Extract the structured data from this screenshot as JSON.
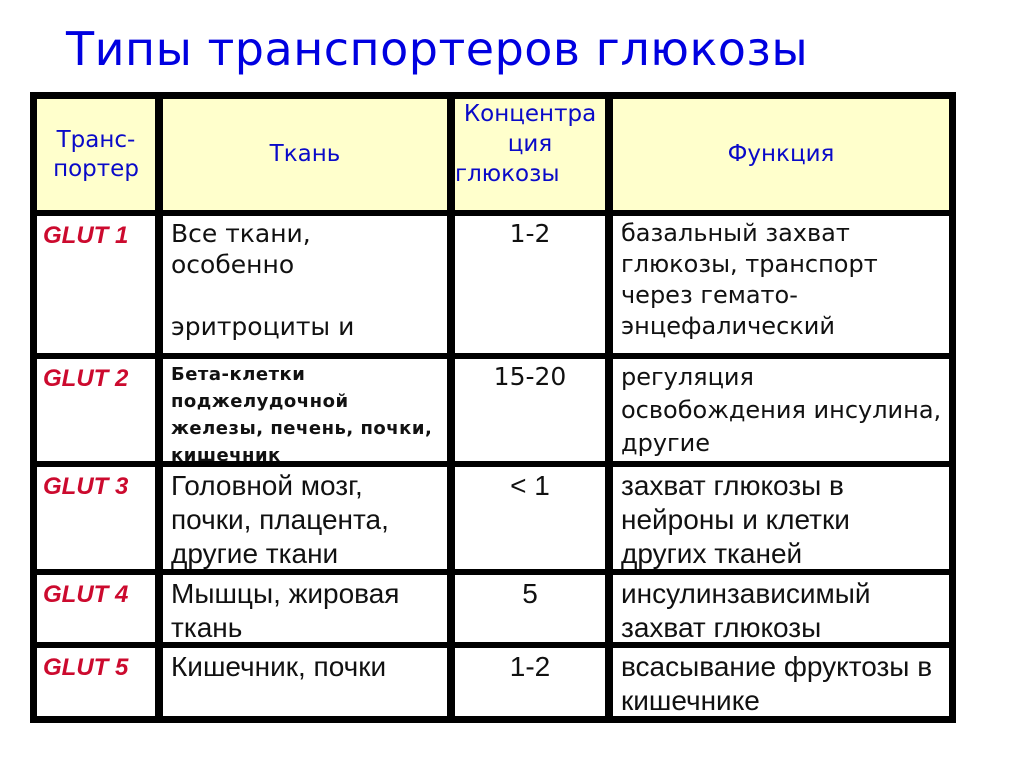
{
  "title": "Типы транспортеров глюкозы",
  "table": {
    "headers": {
      "transporter": "Транс-портер",
      "transporter_line1": "Транс-",
      "transporter_line2": "портер",
      "tissue": "Ткань",
      "concentration_line1": "Концентра",
      "concentration_line2": "ция",
      "concentration_line3": "глюкозы",
      "function": "Функция"
    },
    "rows": [
      {
        "transporter": "GLUT 1",
        "tissue": "Все ткани, особенно\n\nэритроциты и",
        "concentration": "1-2",
        "function": "базальный захват глюкозы, транспорт через гемато-энцефалический"
      },
      {
        "transporter": "GLUT 2",
        "tissue": "Бета-клетки поджелудочной железы, печень, почки, кишечник",
        "concentration": "15-20",
        "function": "регуляция освобождения инсулина, другие"
      },
      {
        "transporter": "GLUT 3",
        "tissue": "Головной мозг, почки, плацента, другие ткани",
        "concentration": "< 1",
        "function": "захват глюкозы в нейроны и клетки других тканей"
      },
      {
        "transporter": "GLUT 4",
        "tissue": "Мышцы, жировая ткань",
        "concentration": "5",
        "function": "инсулинзависимый захват глюкозы"
      },
      {
        "transporter": "GLUT 5",
        "tissue": "Кишечник, почки",
        "concentration": "1-2",
        "function": "всасывание фруктозы в кишечнике"
      }
    ]
  },
  "colors": {
    "title": "#0000e0",
    "header_bg": "#ffffcc",
    "header_text": "#0a0ac8",
    "transporter_text": "#cc0a2e",
    "border": "#000000"
  }
}
